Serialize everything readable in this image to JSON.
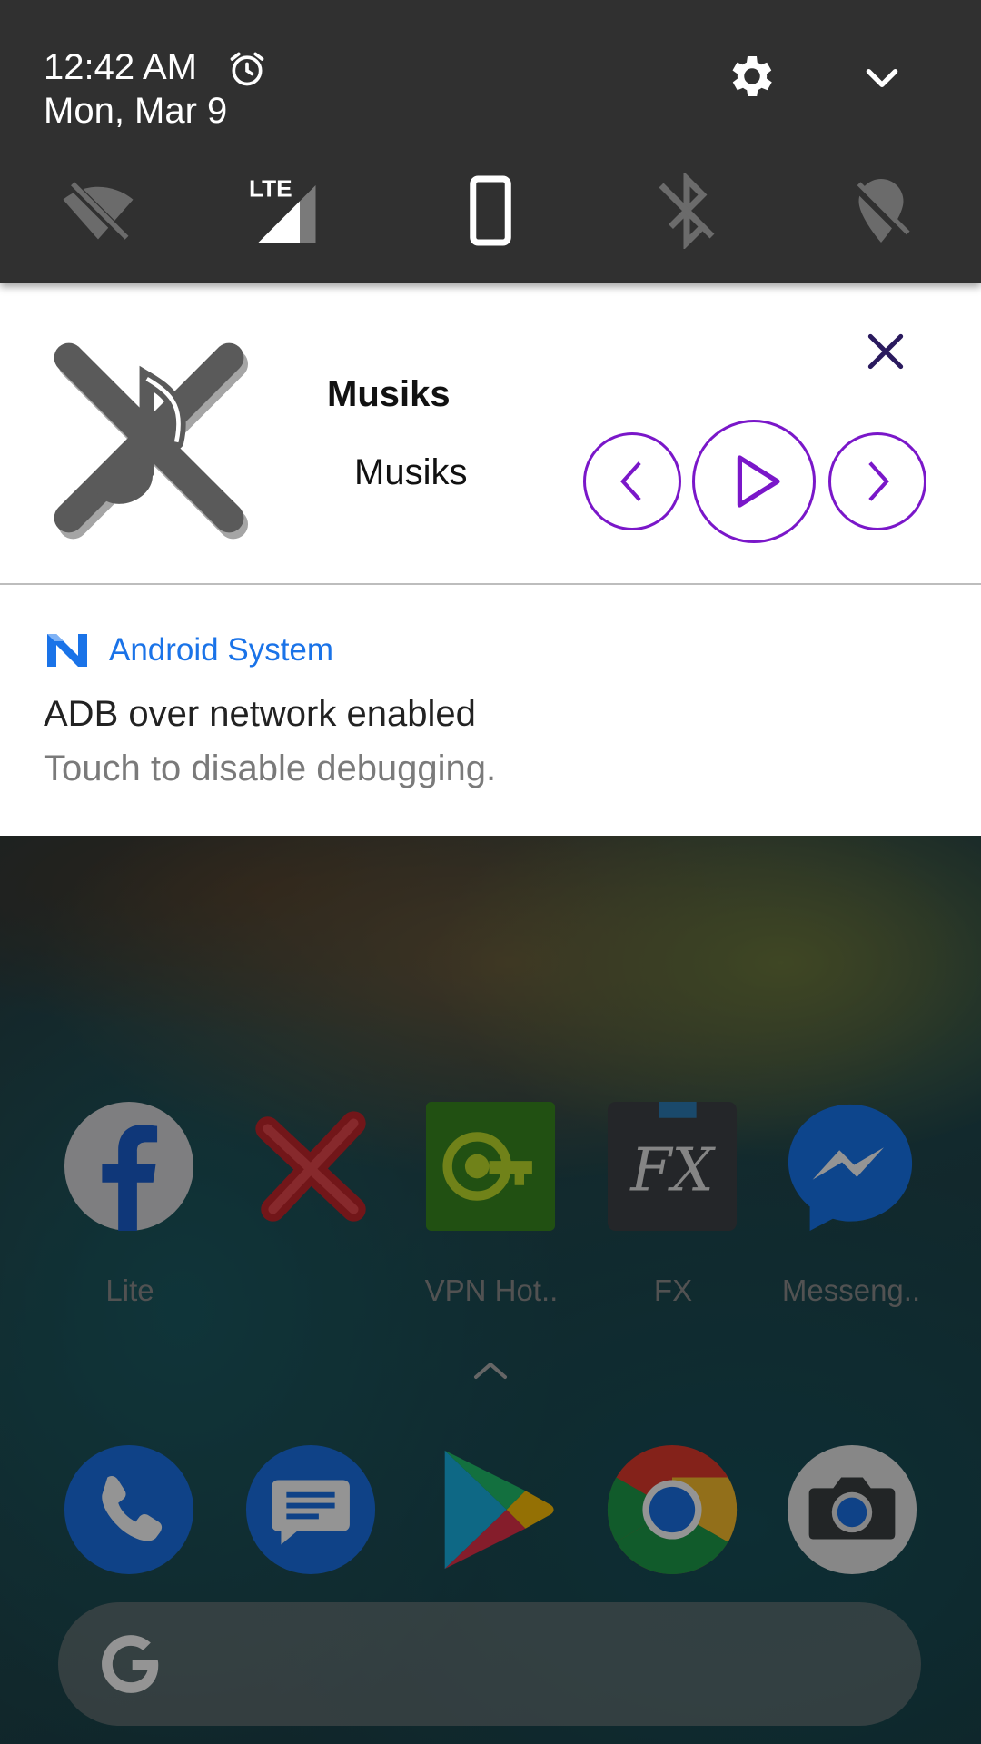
{
  "status": {
    "time": "12:42 AM",
    "date": "Mon, Mar 9",
    "tiles": [
      "wifi-off-icon",
      "lte-signal-icon",
      "auto-rotate-icon",
      "bluetooth-off-icon",
      "location-off-icon"
    ],
    "lte_label": "LTE"
  },
  "media": {
    "title": "Musiks",
    "artist": "Musiks",
    "accent": "#7a17c9"
  },
  "system_notification": {
    "app_name": "Android System",
    "title": "ADB over network enabled",
    "text": "Touch to disable debugging.",
    "accent": "#1a73e8"
  },
  "home": {
    "apps": [
      {
        "label": "Lite",
        "icon": "facebook-lite-icon"
      },
      {
        "label": "",
        "icon": "red-x-icon"
      },
      {
        "label": "VPN Hot..",
        "icon": "vpn-hotspot-icon"
      },
      {
        "label": "FX",
        "icon": "fx-file-explorer-icon"
      },
      {
        "label": "Messeng..",
        "icon": "messenger-icon"
      }
    ],
    "dock": [
      "phone-icon",
      "messages-icon",
      "play-store-icon",
      "chrome-icon",
      "camera-icon"
    ],
    "search_logo": "G"
  }
}
